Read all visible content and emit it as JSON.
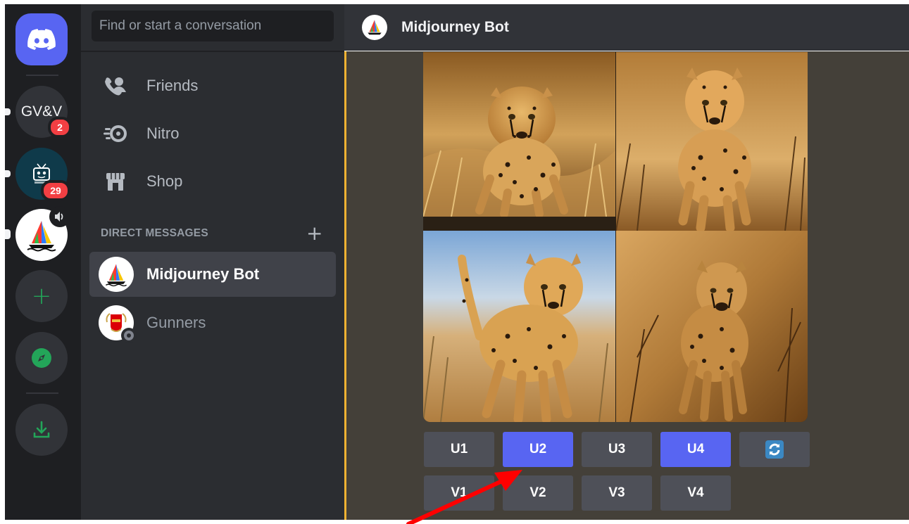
{
  "servers": [
    {
      "name": "home",
      "icon": "discord-logo-icon"
    },
    {
      "name": "gvv",
      "label": "GV&V",
      "badge": "2"
    },
    {
      "name": "dad",
      "badge": "29"
    },
    {
      "name": "midjourney",
      "icon": "midjourney-boat-icon",
      "overlay_icon": "speaker-icon"
    },
    {
      "name": "add-server",
      "label": "+"
    },
    {
      "name": "explore",
      "icon": "compass-icon"
    },
    {
      "name": "download",
      "icon": "download-icon"
    }
  ],
  "search": {
    "placeholder": "Find or start a conversation"
  },
  "nav": [
    {
      "label": "Friends",
      "icon": "friends-icon"
    },
    {
      "label": "Nitro",
      "icon": "nitro-icon"
    },
    {
      "label": "Shop",
      "icon": "shop-icon"
    }
  ],
  "dm_header": "DIRECT MESSAGES",
  "dm_add": "+",
  "dms": [
    {
      "label": "Midjourney Bot",
      "active": true
    },
    {
      "label": "Gunners",
      "active": false
    }
  ],
  "channel_title": "Midjourney Bot",
  "buttons_row1": [
    "U1",
    "U2",
    "U3",
    "U4"
  ],
  "buttons_row2": [
    "V1",
    "V2",
    "V3",
    "V4"
  ],
  "reroll_icon": "refresh-icon",
  "colors": {
    "blurple": "#5865f2",
    "button_gray": "#4e5058",
    "badge_red": "#f23f43",
    "accent_gold": "#f0b232",
    "annotation_arrow": "#ff0000"
  }
}
